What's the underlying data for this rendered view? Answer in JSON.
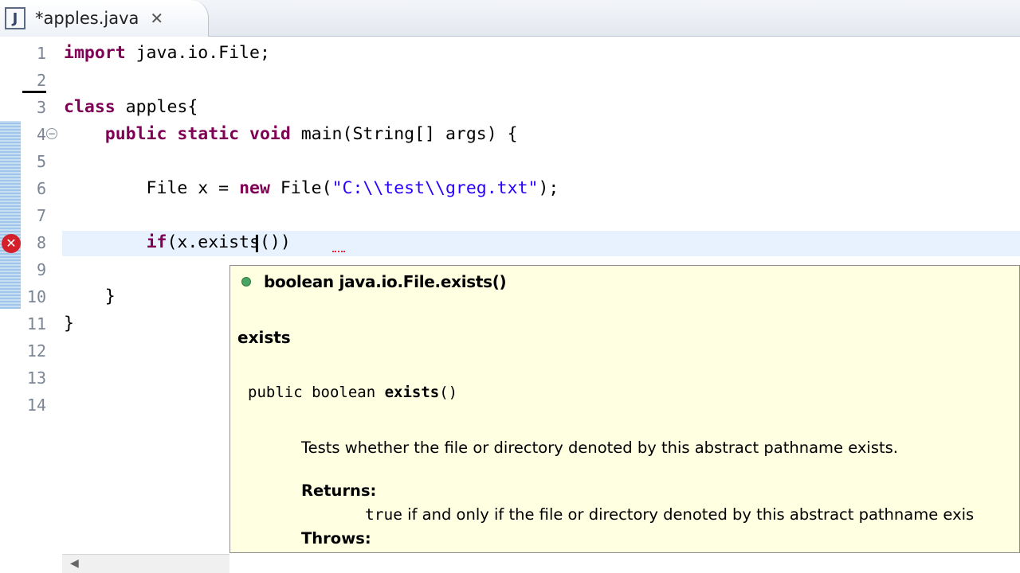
{
  "tab": {
    "icon": "java-file-icon",
    "icon_glyph": "J",
    "title": "*apples.java",
    "close_glyph": "✕"
  },
  "editor": {
    "lines": [
      {
        "num": "1",
        "code": "import java.io.File;"
      },
      {
        "num": "2",
        "code": ""
      },
      {
        "num": "3",
        "code": "class apples{"
      },
      {
        "num": "4",
        "code": "    public static void main(String[] args) {"
      },
      {
        "num": "5",
        "code": ""
      },
      {
        "num": "6",
        "code": "        File x = new File(\"C:\\\\test\\\\greg.txt\");"
      },
      {
        "num": "7",
        "code": ""
      },
      {
        "num": "8",
        "code": "        if(x.exists())"
      },
      {
        "num": "9",
        "code": ""
      },
      {
        "num": "10",
        "code": "    }"
      },
      {
        "num": "11",
        "code": "}"
      },
      {
        "num": "12",
        "code": ""
      },
      {
        "num": "13",
        "code": "",
        "raw": ""
      },
      {
        "num": "14",
        "code": ""
      }
    ],
    "fold_glyph": "−",
    "error_glyph": "✕"
  },
  "popup": {
    "title": "boolean java.io.File.exists()",
    "name": "exists",
    "signature_prefix": "public boolean ",
    "signature_method": "exists",
    "signature_suffix": "()",
    "description": "Tests whether the file or directory denoted by this abstract pathname exists.",
    "returns_label": "Returns:",
    "returns_keyword": "true",
    "returns_text": " if and only if the file or directory denoted by this abstract pathname exis",
    "throws_label": "Throws:"
  },
  "colors": {
    "keyword": "#7f0055",
    "string": "#2a00ff",
    "popup_bg": "#ffffe1",
    "current_line": "#e8f2fe"
  }
}
